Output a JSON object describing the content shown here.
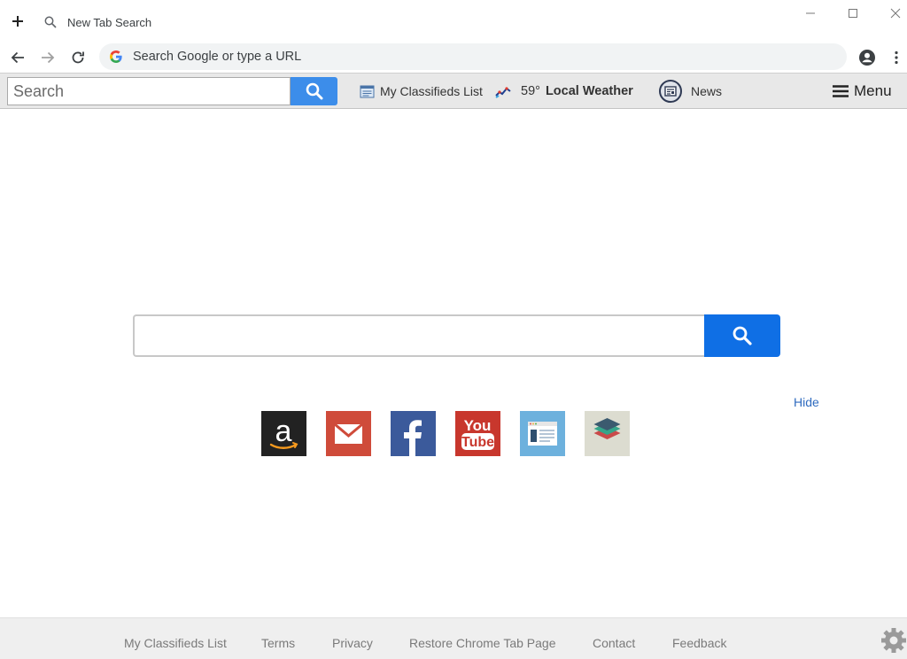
{
  "browser": {
    "tab_title": "New Tab Search",
    "omnibox_placeholder": "Search Google or type a URL"
  },
  "toolbar": {
    "search_placeholder": "Search",
    "classifieds_label": "My Classifieds List",
    "weather_temp": "59°",
    "weather_label": "Local Weather",
    "news_label": "News",
    "menu_label": "Menu"
  },
  "main": {
    "search_value": "",
    "hide_label": "Hide",
    "quick_links": [
      {
        "name": "amazon",
        "icon": "amazon-icon",
        "color": "#222222"
      },
      {
        "name": "gmail",
        "icon": "mail-icon",
        "color": "#cf4b3a"
      },
      {
        "name": "facebook",
        "icon": "facebook-icon",
        "color": "#3b5a9b"
      },
      {
        "name": "youtube",
        "icon": "youtube-icon",
        "color": "#c8372d"
      },
      {
        "name": "news",
        "icon": "browser-window-icon",
        "color": "#6db1dd"
      },
      {
        "name": "layers",
        "icon": "layers-icon",
        "color": "#dcdcd0"
      }
    ]
  },
  "footer": {
    "links": [
      "My Classifieds List",
      "Terms",
      "Privacy",
      "Restore Chrome Tab Page",
      "Contact",
      "Feedback"
    ]
  },
  "colors": {
    "accent_blue": "#0f6fe5",
    "toolbar_blue": "#3c8dea",
    "link_blue": "#2f6bbf"
  }
}
